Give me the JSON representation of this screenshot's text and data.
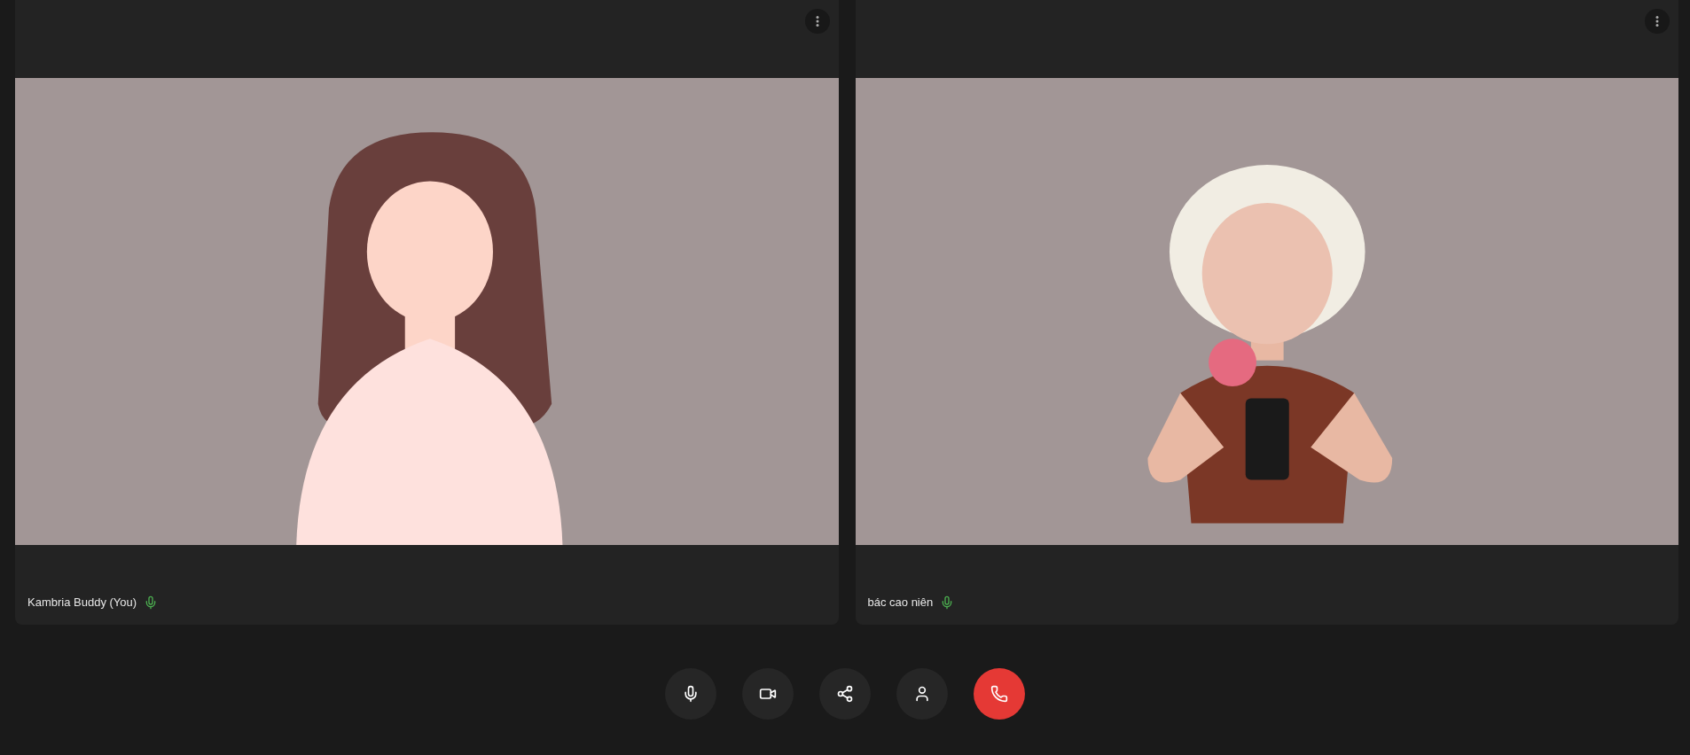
{
  "participants": [
    {
      "name": "Kambria Buddy (You)",
      "muted": false
    },
    {
      "name": "bác cao niên",
      "muted": false
    }
  ],
  "controls": [
    {
      "kind": "mic"
    },
    {
      "kind": "camera"
    },
    {
      "kind": "share"
    },
    {
      "kind": "person"
    },
    {
      "kind": "hangup"
    }
  ]
}
